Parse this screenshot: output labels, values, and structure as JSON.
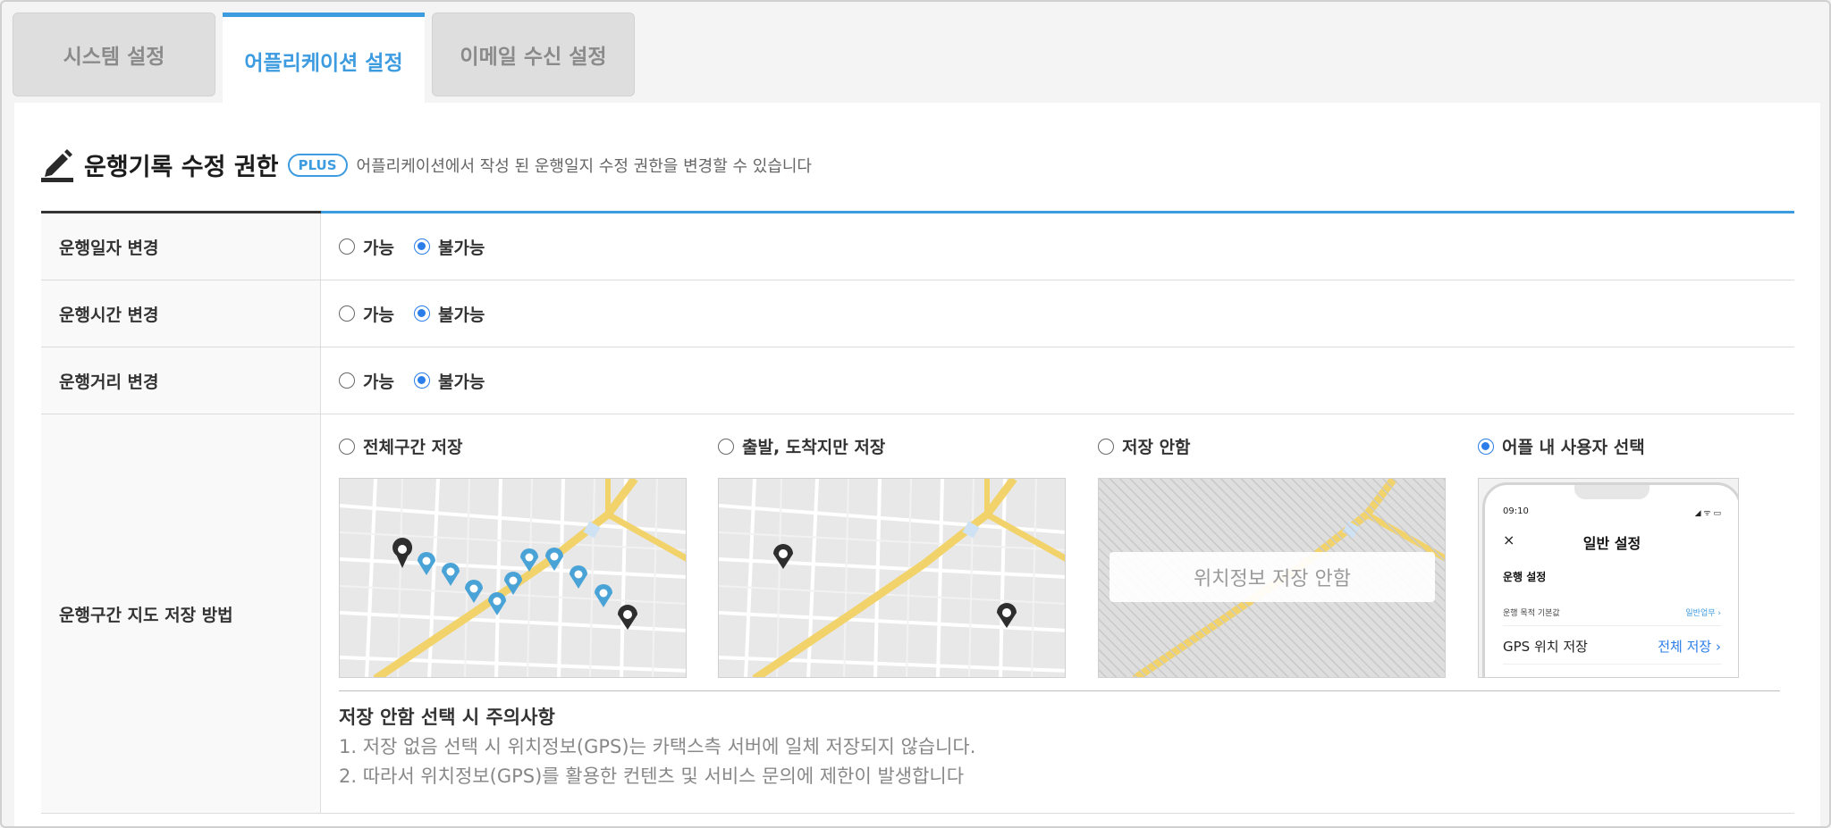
{
  "tabs": [
    {
      "label": "시스템 설정",
      "active": false
    },
    {
      "label": "어플리케이션 설정",
      "active": true
    },
    {
      "label": "이메일 수신 설정",
      "active": false
    }
  ],
  "section": {
    "title": "운행기록 수정 권한",
    "badge": "PLUS",
    "description": "어플리케이션에서 작성 된 운행일지 수정 권한을 변경할 수 있습니다"
  },
  "rows": [
    {
      "label": "운행일자 변경",
      "options": [
        "가능",
        "불가능"
      ],
      "selected": "불가능"
    },
    {
      "label": "운행시간 변경",
      "options": [
        "가능",
        "불가능"
      ],
      "selected": "불가능"
    },
    {
      "label": "운행거리 변경",
      "options": [
        "가능",
        "불가능"
      ],
      "selected": "불가능"
    }
  ],
  "map_row": {
    "label": "운행구간 지도 저장 방법",
    "options": [
      {
        "label": "전체구간 저장",
        "selected": false
      },
      {
        "label": "출발, 도착지만 저장",
        "selected": false
      },
      {
        "label": "저장 안함",
        "selected": false,
        "overlay": "위치정보 저장 안함"
      },
      {
        "label": "어플 내 사용자 선택",
        "selected": true
      }
    ],
    "phone": {
      "time": "09:10",
      "status": "◢ ᯤ ▭",
      "close": "×",
      "title": "일반 설정",
      "section": "운행 설정",
      "row1_label": "운행 목적 기본값",
      "row1_value": "일반업무 ›",
      "row2_label": "GPS 위치 저장",
      "row2_value": "전체 저장 ›"
    },
    "notice": {
      "title": "저장 안함 선택 시 주의사항",
      "line1": "1. 저장 없음 선택 시 위치정보(GPS)는 카택스측 서버에 일체 저장되지 않습니다.",
      "line2": "2. 따라서 위치정보(GPS)를 활용한 컨텐츠 및 서비스 문의에 제한이 발생합니다"
    }
  },
  "colors": {
    "accent": "#3d9be0",
    "radio": "#2b7de9",
    "map_road": "#f2d36b",
    "pin_blue": "#4aa3d6",
    "pin_dark": "#2e2e2e"
  }
}
